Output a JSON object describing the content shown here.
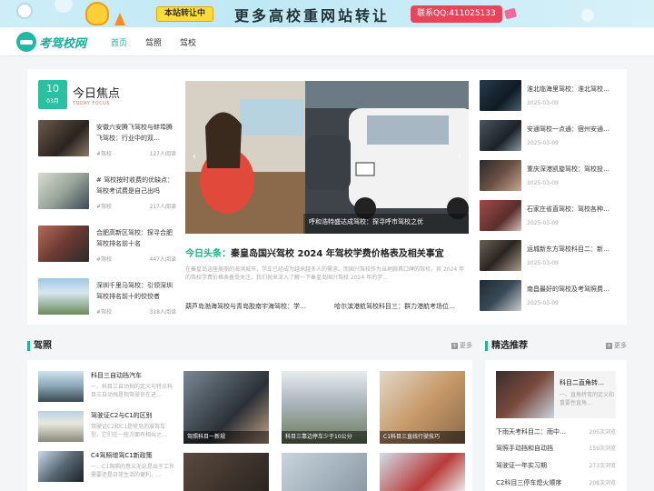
{
  "banner": {
    "tag": "本站转让中",
    "headline": "更多高校重网站转让",
    "contact": "联系QQ:411025133"
  },
  "header": {
    "logo_text": "考驾校网",
    "nav": [
      "首页",
      "驾照",
      "驾校"
    ],
    "active_index": 0
  },
  "focus": {
    "day": "10",
    "month": "03月",
    "title": "今日焦点",
    "subtitle": "TODAY FOCUS",
    "left_news": [
      {
        "title": "安徽六安腾飞驾校与蚌埠腾飞驾校：行业中的双…",
        "category": "#驾校",
        "reads": "127人阅读"
      },
      {
        "title": "# 驾校按时收费的优缺点：驾校考试费是自己出吗",
        "category": "#驾校",
        "reads": "217人阅读"
      },
      {
        "title": "合肥高新区驾校：探寻合肥驾校排名前十名",
        "category": "#驾校",
        "reads": "447人阅读"
      },
      {
        "title": "深圳千里马驾校：引领深圳驾校排名前十的佼佼者",
        "category": "#驾校",
        "reads": "318人阅读"
      }
    ],
    "slider_caption": "呼和浩特盛达成驾校：探寻呼市驾校之优",
    "headline_label": "今日头条：",
    "headline_title": "秦皇岛国兴驾校 2024 年驾校学费价格表及相关事宜",
    "headline_desc": "在秦皇岛这座美丽的海滨城市，学车已经成为越来越多人的需求。而国兴驾校作为当地颇具口碑的驾校，其 2024 年的驾校学费价格表备受关注。我们就来深入了解一下秦皇岛国兴驾校 2024 年的学…",
    "sub_links": [
      "葫芦岛渤海驾校与青岛胶南宇海驾校：学…",
      "哈尔滨港航驾校科目三：群力港航考场位…"
    ],
    "right_news": [
      {
        "title": "淮北临海里驾校：淮北驾校…",
        "date": "2025-03-09"
      },
      {
        "title": "安通驾校一点通：宿州安通…",
        "date": "2025-03-09"
      },
      {
        "title": "重庆深港凯旋驾校：驾校投…",
        "date": "2025-03-09"
      },
      {
        "title": "石家庄省直驾校：驾校各种…",
        "date": "2025-03-09"
      },
      {
        "title": "运城新东方驾校科目二：新…",
        "date": "2025-03-09"
      },
      {
        "title": "南昌最好的驾校及考驾照费…",
        "date": "2025-03-09"
      }
    ]
  },
  "license": {
    "title": "驾照",
    "more": "更多",
    "list": [
      {
        "title": "科目三自动挡汽车",
        "desc": "一、科目三自动挡的定义与特点科目三自动挡是指驾驶员在进…"
      },
      {
        "title": "驾驶证C2与C1的区别",
        "desc": "驾驶证C2和C1是常见的准驾车型，它们在一些方面有相似之…"
      },
      {
        "title": "C4驾照增驾C1新政策",
        "desc": "一、C1驾照的意义无论是出于工作需要还是日常生活的便利，…"
      }
    ],
    "tiles": [
      "驾照科目一新规",
      "科目三靠边停车少于10公分",
      "C1科目三直线行驶技巧"
    ]
  },
  "picks": {
    "title": "精选推荐",
    "more": "更多",
    "feature_title": "科目二直角转…",
    "feature_desc": "一、直角转弯的定义和重要性直角…",
    "ranks": [
      {
        "title": "下雨天考科目二：雨中…",
        "reads": "205次浏览"
      },
      {
        "title": "驾照手动挡和自动挡",
        "reads": "159次浏览"
      },
      {
        "title": "驾驶证一年实习期",
        "reads": "273次浏览"
      },
      {
        "title": "C2科目三停车熄火顺序",
        "reads": "208次浏览"
      }
    ]
  }
}
